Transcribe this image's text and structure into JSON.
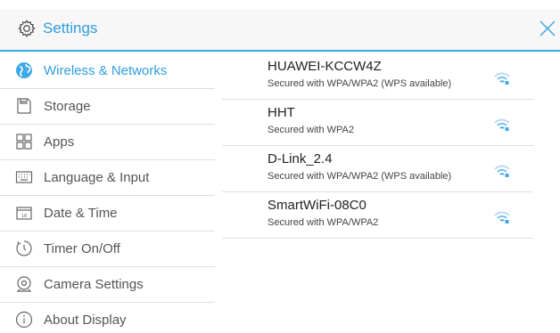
{
  "header": {
    "title": "Settings",
    "icon": "gear-icon",
    "close_icon": "close-icon",
    "accent_color": "#2f9de0"
  },
  "sidebar": {
    "items": [
      {
        "label": "Wireless & Networks",
        "icon": "globe-icon",
        "active": true
      },
      {
        "label": "Storage",
        "icon": "storage-icon",
        "active": false
      },
      {
        "label": "Apps",
        "icon": "apps-grid-icon",
        "active": false
      },
      {
        "label": "Language & Input",
        "icon": "keyboard-icon",
        "active": false
      },
      {
        "label": "Date & Time",
        "icon": "calendar-icon",
        "active": false
      },
      {
        "label": "Timer On/Off",
        "icon": "timer-icon",
        "active": false
      },
      {
        "label": "Camera Settings",
        "icon": "camera-icon",
        "active": false
      },
      {
        "label": "About Display",
        "icon": "info-icon",
        "active": false
      }
    ]
  },
  "networks": [
    {
      "ssid": "HUAWEI-KCCW4Z",
      "security": "Secured with WPA/WPA2 (WPS available)",
      "icon": "wifi-icon"
    },
    {
      "ssid": "HHT",
      "security": "Secured with WPA2",
      "icon": "wifi-icon"
    },
    {
      "ssid": "D-Link_2.4",
      "security": "Secured with WPA/WPA2 (WPS available)",
      "icon": "wifi-icon"
    },
    {
      "ssid": "SmartWiFi-08C0",
      "security": "Secured with WPA/WPA2",
      "icon": "wifi-icon"
    }
  ]
}
